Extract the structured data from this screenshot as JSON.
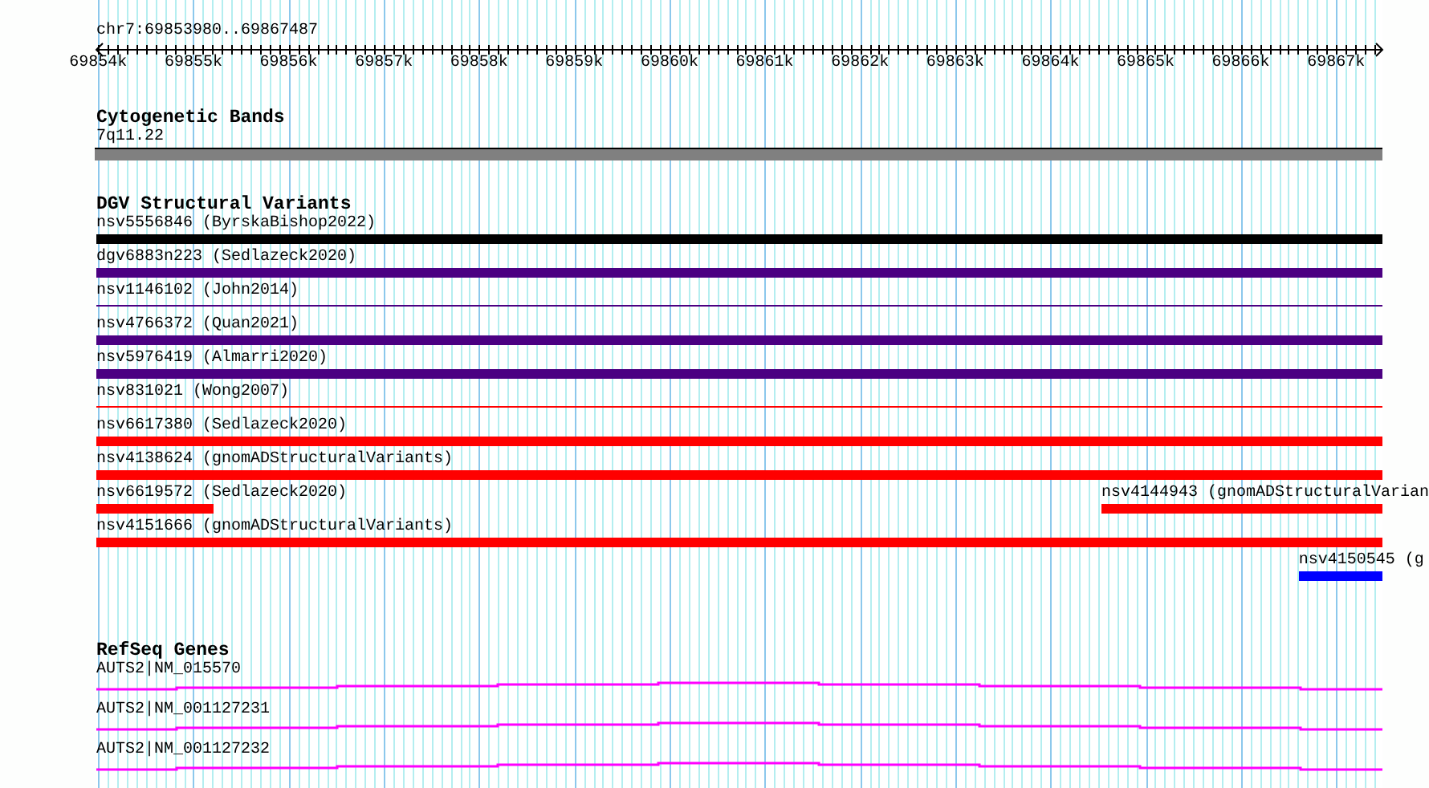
{
  "ruler": {
    "location": "chr7:69853980..69867487",
    "ticks": [
      "69854k",
      "69855k",
      "69856k",
      "69857k",
      "69858k",
      "69859k",
      "69860k",
      "69861k",
      "69862k",
      "69863k",
      "69864k",
      "69865k",
      "69866k",
      "69867k"
    ]
  },
  "cytogenetic_bands": {
    "title": "Cytogenetic Bands",
    "bands": [
      {
        "label": "7q11.22"
      }
    ]
  },
  "dgv_structural_variants": {
    "title": "DGV Structural Variants",
    "rows": [
      {
        "features": [
          {
            "label": "nsv5556846 (ByrskaBishop2022)",
            "color": "#000000",
            "kind": "bar"
          }
        ]
      },
      {
        "features": [
          {
            "label": "dgv6883n223 (Sedlazeck2020)",
            "color": "#4b0082",
            "kind": "bar"
          }
        ]
      },
      {
        "features": [
          {
            "label": "nsv1146102 (John2014)",
            "color": "#4b0082",
            "kind": "line"
          }
        ]
      },
      {
        "features": [
          {
            "label": "nsv4766372 (Quan2021)",
            "color": "#4b0082",
            "kind": "bar"
          }
        ]
      },
      {
        "features": [
          {
            "label": "nsv5976419 (Almarri2020)",
            "color": "#4b0082",
            "kind": "bar"
          }
        ]
      },
      {
        "features": [
          {
            "label": "nsv831021 (Wong2007)",
            "color": "#ff0000",
            "kind": "line"
          }
        ]
      },
      {
        "features": [
          {
            "label": "nsv6617380 (Sedlazeck2020)",
            "color": "#ff0000",
            "kind": "bar"
          }
        ]
      },
      {
        "features": [
          {
            "label": "nsv4138624 (gnomADStructuralVariants)",
            "color": "#ff0000",
            "kind": "bar"
          }
        ]
      },
      {
        "features": [
          {
            "label": "nsv6619572 (Sedlazeck2020)",
            "color": "#ff0000",
            "kind": "bar"
          },
          {
            "label": "nsv4144943 (gnomADStructuralVarian",
            "color": "#ff0000",
            "kind": "bar"
          }
        ]
      },
      {
        "features": [
          {
            "label": "nsv4151666 (gnomADStructuralVariants)",
            "color": "#ff0000",
            "kind": "bar"
          }
        ]
      },
      {
        "features": [
          {
            "label": "nsv4150545 (g",
            "color": "#0000ff",
            "kind": "bar"
          }
        ]
      }
    ]
  },
  "refseq_genes": {
    "title": "RefSeq Genes",
    "transcripts": [
      {
        "label": "AUTS2|NM_015570"
      },
      {
        "label": "AUTS2|NM_001127231"
      },
      {
        "label": "AUTS2|NM_001127232"
      }
    ]
  }
}
